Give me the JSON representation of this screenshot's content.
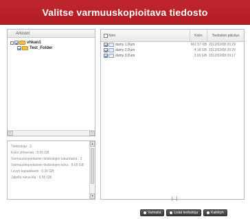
{
  "title": "Valitse varmuuskopioitava tiedosto",
  "folders": {
    "header": "Arkistot",
    "tree": [
      {
        "label": "vhkan1",
        "level": 0,
        "checked": true
      },
      {
        "label": "Test_Folder",
        "level": 1,
        "checked": true
      }
    ]
  },
  "info": {
    "lines": [
      "Tiedostoja : 3",
      "Koko yhteensä : 8.65 GB",
      "Varmuuskopioitavien tiedostojen lukumäärä : 3",
      "Varmuuskopioitavien tiedostojen koko : 8.65 GB",
      "Levyn kapasiteetti : 6.30 GB",
      "Jäljellä oleva tila : 6.55 GB"
    ]
  },
  "files": {
    "columns": {
      "name": "Nimi",
      "size": "Koko",
      "date": "Tiedoston päiväys"
    },
    "rows": [
      {
        "name": "dumy 1.Dum",
        "size": "667.57 KB",
        "date": "2012/02/08 20:29",
        "checked": true
      },
      {
        "name": "dumy 2.Dum",
        "size": "4.18 GB",
        "date": "2012/02/08 20:29",
        "checked": true
      },
      {
        "name": "dumy 3.Dum",
        "size": "3.00 GB",
        "date": "2012/02/08 09:17",
        "checked": true
      }
    ],
    "page_indicator": "[...]"
  },
  "buttons": {
    "back": "Varmista",
    "start": "Lisää tiedostoja",
    "cancel": "Kaikkiyh"
  }
}
